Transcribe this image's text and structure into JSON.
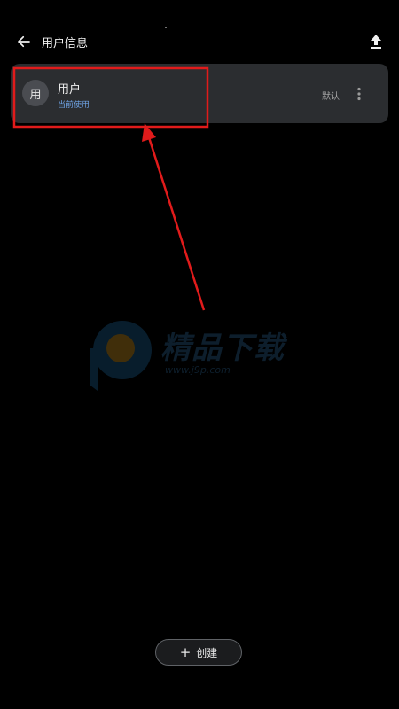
{
  "header": {
    "title": "用户信息",
    "back_icon": "arrow-left-icon",
    "upload_icon": "upload-icon"
  },
  "profile": {
    "avatar_text": "用",
    "name": "用户",
    "status": "当前使用",
    "default_label": "默认",
    "more_icon": "more-vertical-icon"
  },
  "watermark": {
    "title": "精品下载",
    "url": "www.j9p.com"
  },
  "create_button": {
    "icon": "plus-icon",
    "label": "创建"
  },
  "colors": {
    "background": "#000000",
    "card": "#2b2d30",
    "accent_blue": "#6fa4e6",
    "annotation_red": "#e11b1b"
  }
}
